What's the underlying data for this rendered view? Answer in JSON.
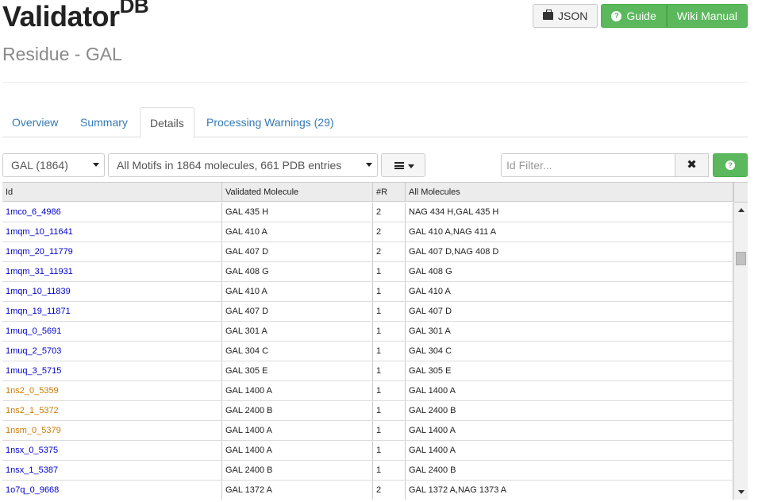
{
  "header": {
    "title": "Validator",
    "title_sup": "DB",
    "subtitle": "Residue - GAL",
    "json_button": "JSON",
    "guide_button": "Guide",
    "wiki_button": "Wiki Manual"
  },
  "tabs": [
    {
      "label": "Overview",
      "active": false
    },
    {
      "label": "Summary",
      "active": false
    },
    {
      "label": "Details",
      "active": true
    },
    {
      "label": "Processing Warnings (29)",
      "active": false
    }
  ],
  "toolbar": {
    "residue_select": "GAL (1864)",
    "motif_select": "All Motifs in 1864 molecules, 661 PDB entries",
    "filter_placeholder": "Id Filter...",
    "clear_label": "✖",
    "help_label": "?"
  },
  "colors": {
    "link_blue": "#0000cc",
    "link_orange": "#cc7a00",
    "green": "#5cb85c",
    "tab_blue": "#337ab7"
  },
  "table": {
    "columns": [
      "Id",
      "Validated Molecule",
      "#R",
      "All Molecules"
    ],
    "rows": [
      {
        "id": "1mco_6_4986",
        "color": "blue",
        "validated": "GAL 435 H",
        "r": "2",
        "all": "NAG 434 H,GAL 435 H"
      },
      {
        "id": "1mqm_10_11641",
        "color": "blue",
        "validated": "GAL 410 A",
        "r": "2",
        "all": "GAL 410 A,NAG 411 A"
      },
      {
        "id": "1mqm_20_11779",
        "color": "blue",
        "validated": "GAL 407 D",
        "r": "2",
        "all": "GAL 407 D,NAG 408 D"
      },
      {
        "id": "1mqm_31_11931",
        "color": "blue",
        "validated": "GAL 408 G",
        "r": "1",
        "all": "GAL 408 G"
      },
      {
        "id": "1mqn_10_11839",
        "color": "blue",
        "validated": "GAL 410 A",
        "r": "1",
        "all": "GAL 410 A"
      },
      {
        "id": "1mqn_19_11871",
        "color": "blue",
        "validated": "GAL 407 D",
        "r": "1",
        "all": "GAL 407 D"
      },
      {
        "id": "1muq_0_5691",
        "color": "blue",
        "validated": "GAL 301 A",
        "r": "1",
        "all": "GAL 301 A"
      },
      {
        "id": "1muq_2_5703",
        "color": "blue",
        "validated": "GAL 304 C",
        "r": "1",
        "all": "GAL 304 C"
      },
      {
        "id": "1muq_3_5715",
        "color": "blue",
        "validated": "GAL 305 E",
        "r": "1",
        "all": "GAL 305 E"
      },
      {
        "id": "1ns2_0_5359",
        "color": "orange",
        "validated": "GAL 1400 A",
        "r": "1",
        "all": "GAL 1400 A"
      },
      {
        "id": "1ns2_1_5372",
        "color": "orange",
        "validated": "GAL 2400 B",
        "r": "1",
        "all": "GAL 2400 B"
      },
      {
        "id": "1nsm_0_5379",
        "color": "orange",
        "validated": "GAL 1400 A",
        "r": "1",
        "all": "GAL 1400 A"
      },
      {
        "id": "1nsx_0_5375",
        "color": "blue",
        "validated": "GAL 1400 A",
        "r": "1",
        "all": "GAL 1400 A"
      },
      {
        "id": "1nsx_1_5387",
        "color": "blue",
        "validated": "GAL 2400 B",
        "r": "1",
        "all": "GAL 2400 B"
      },
      {
        "id": "1o7q_0_9668",
        "color": "blue",
        "validated": "GAL 1372 A",
        "r": "2",
        "all": "GAL 1372 A,NAG 1373 A"
      }
    ]
  }
}
